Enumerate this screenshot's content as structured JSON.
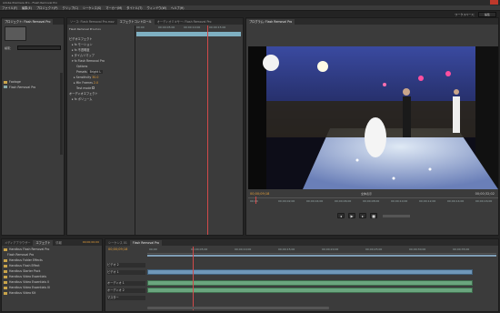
{
  "app": {
    "title": "Adobe Premiere Pro - Flash Removal Pro"
  },
  "menu": [
    "ファイル(F)",
    "編集(E)",
    "プロジェクト(P)",
    "クリップ(C)",
    "シーケンス(S)",
    "マーカー(M)",
    "タイトル(T)",
    "ウィンドウ(W)",
    "ヘルプ(H)"
  ],
  "workspace": {
    "label": "ワークスペース：",
    "value": "編集"
  },
  "project_panel": {
    "tab": "プロジェクト: Flash Removal Pro",
    "search_label": "検索：",
    "items": [
      "Footage",
      "Flash Removal Pro"
    ]
  },
  "effect_controls": {
    "tabs": [
      "ソース: Flash Removal Pro.mov",
      "エフェクトコントロール",
      "オーディオミキサー: Flash Removal Pro"
    ],
    "clip": "Flash Removal Pro.mov",
    "times": [
      "00:00",
      "00:00:05:00",
      "00:00:10:00",
      "00:00:15:00"
    ],
    "sections": [
      "ビデオエフェクト",
      "モーション",
      "不透明度",
      "タイムリマップ",
      "Flash Removal Pro",
      "Options",
      "Presets",
      "Sensitivity",
      "Min Frames",
      "Test mode",
      "オーディオエフェクト",
      "ボリューム"
    ],
    "values": {
      "presets": "Bright L",
      "sensitivity": "30.0",
      "min_frames": "2.0"
    }
  },
  "program_monitor": {
    "tab": "プログラム: Flash Removal Pro",
    "timecode": "00;00;09;18",
    "duration": "00;00;32;02",
    "fit": "全体表示",
    "ruler": [
      "00;00",
      "00;00;02;00",
      "00;00;04;00",
      "00;00;06;00",
      "00;00;08;00",
      "00;00;10;00",
      "00;00;12;00",
      "00;00;14;00",
      "00;00;16;00"
    ]
  },
  "media_browser": {
    "tabs": [
      "メディアブラウザー",
      "エフェクト",
      "情報"
    ],
    "timecode": "00;00;00;00",
    "items": [
      "Handbus Flash Removal Pro",
      "Flash Removal Pro",
      "Handbus Folder Effects",
      "Handbus Flash Effect",
      "Handbus Starter Pack",
      "Handbus Video Essentials",
      "Handbus Video Essentials II",
      "Handbus Video Essentials III",
      "Handbus Video Kit"
    ]
  },
  "timeline": {
    "tabs": [
      "シーケンス 01",
      "Flash Removal Pro"
    ],
    "timecode": "00;00;09;18",
    "ruler": [
      "00;00",
      "00;00;05;00",
      "00;00;10;00",
      "00;00;15;00",
      "00;00;20;00",
      "00;00;25;00",
      "00;00;30;00",
      "00;00;35;00",
      "00;00;40;00"
    ],
    "tracks": [
      "ビデオ 2",
      "ビデオ 1",
      "オーディオ 1",
      "オーディオ 2",
      "マスター"
    ]
  },
  "colors": {
    "accent": "#e8a13a",
    "playhead": "#d14a4a",
    "selection": "#6f97b8"
  },
  "icons": {
    "play": "play-icon",
    "stop": "stop-icon",
    "step_back": "step-back-icon",
    "step_forward": "step-forward-icon"
  }
}
